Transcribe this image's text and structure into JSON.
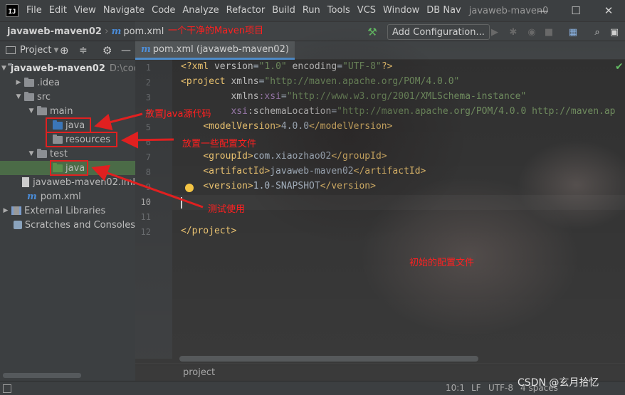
{
  "menubar": {
    "logo": "IJ",
    "items": [
      "File",
      "Edit",
      "View",
      "Navigate",
      "Code",
      "Analyze",
      "Refactor",
      "Build",
      "Run",
      "Tools",
      "VCS",
      "Window",
      "DB Nav"
    ],
    "window_title": "javaweb-maven0",
    "buttons": {
      "minimize": "—",
      "maximize": "☐",
      "close": "✕"
    }
  },
  "navbar": {
    "project": "javaweb-maven02",
    "file": "pom.xml",
    "add_configuration": "Add Configuration..."
  },
  "project_panel": {
    "title": "Project",
    "tree": [
      {
        "label": "javaweb-maven02",
        "hint": "D:\\cod"
      },
      {
        "label": ".idea"
      },
      {
        "label": "src"
      },
      {
        "label": "main"
      },
      {
        "label": "java"
      },
      {
        "label": "resources"
      },
      {
        "label": "test"
      },
      {
        "label": "java"
      },
      {
        "label": "javaweb-maven02.iml"
      },
      {
        "label": "pom.xml"
      },
      {
        "label": "External Libraries"
      },
      {
        "label": "Scratches and Consoles"
      }
    ]
  },
  "editor": {
    "tab": "pom.xml (javaweb-maven02)",
    "line_numbers": [
      "1",
      "2",
      "3",
      "4",
      "5",
      "6",
      "7",
      "8",
      "9",
      "10",
      "11",
      "12"
    ],
    "lines": {
      "l1": {
        "a": "<?xml ",
        "b": "version",
        "c": "=",
        "d": "\"1.0\"",
        "e": " encoding",
        "f": "=",
        "g": "\"UTF-8\"",
        "h": "?>"
      },
      "l2": {
        "a": "<project ",
        "b": "xmlns",
        "c": "=",
        "d": "\"http://maven.apache.org/POM/4.0.0\""
      },
      "l3": {
        "b": "xmlns",
        "ns": ":xsi",
        "c": "=",
        "d": "\"http://www.w3.org/2001/XMLSchema-instance\""
      },
      "l4": {
        "ns": "xsi",
        "b": ":schemaLocation",
        "c": "=",
        "d": "\"http://maven.apache.org/POM/4.0.0 http://maven.ap"
      },
      "l5": {
        "open": "<modelVersion>",
        "text": "4.0.0",
        "close": "</modelVersion>"
      },
      "l7": {
        "open": "<groupId>",
        "text": "com.xiaozhao02",
        "close": "</groupId>"
      },
      "l8": {
        "open": "<artifactId>",
        "text": "javaweb-maven02",
        "close": "</artifactId>"
      },
      "l9": {
        "open": "<version>",
        "text": "1.0-SNAPSHOT",
        "close": "</version>"
      },
      "l12": {
        "close": "</project>"
      }
    },
    "breadcrumb": "project"
  },
  "statusbar": {
    "position": "10:1",
    "line_sep": "LF",
    "encoding": "UTF-8",
    "indent": "4 spaces"
  },
  "annotations": {
    "clean_project": "一个干净的Maven项目",
    "java_source": "放置Java源代码",
    "config_files": "放置一些配置文件",
    "test_use": "测试使用",
    "initial_config": "初始的配置文件",
    "watermark": "CSDN @玄月拾忆"
  },
  "colors": {
    "annotation_red": "#ff2020",
    "selected_row": "#4b6b47",
    "tag": "#e8bf6a",
    "string": "#6a8759"
  }
}
